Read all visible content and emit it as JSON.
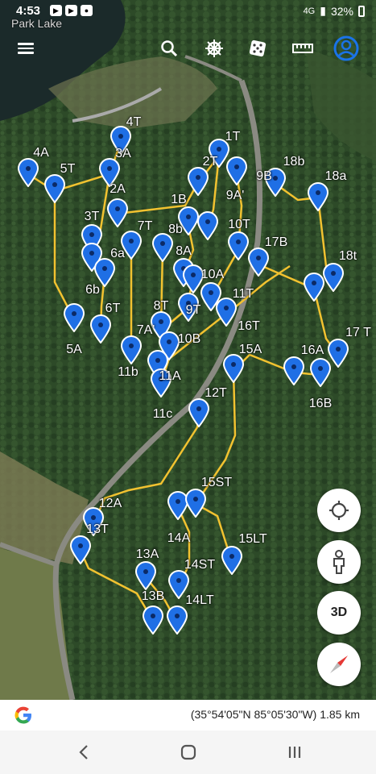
{
  "status_bar": {
    "time": "4:53",
    "signal": "4G",
    "battery": "32%"
  },
  "map_label": "Park Lake",
  "toolbar": {
    "menu": "menu-icon",
    "search": "search-icon",
    "voyager": "ship-wheel-icon",
    "feeling_lucky": "dice-icon",
    "measure": "ruler-icon",
    "account": "account-icon"
  },
  "controls": {
    "location": "my-location-icon",
    "street_view": "pegman-icon",
    "three_d": "3D",
    "compass": "compass-icon"
  },
  "footer": {
    "coordinates": "(35°54'05\"N 85°05'30\"W) 1.85 km"
  },
  "nav": {
    "back": "back-icon",
    "home": "home-icon",
    "recents": "recents-icon"
  },
  "colors": {
    "route": "#f2c230",
    "pin": "#1f6fe5",
    "accent": "#1a73e8"
  },
  "labels": [
    "4T",
    "4A",
    "3A",
    "5T",
    "2A",
    "1T",
    "2T",
    "18b",
    "9B",
    "18a",
    "1B",
    "9A'",
    "3T",
    "7T",
    "8b",
    "10T",
    "17B",
    "6a",
    "8A",
    "18t",
    "6b",
    "10A",
    "11T",
    "6T",
    "8T",
    "9T",
    "5A",
    "7A'",
    "10B",
    "16T",
    "17 T",
    "15A",
    "16A",
    "11b",
    "11A",
    "11c",
    "12T",
    "16B",
    "15ST",
    "12A",
    "13T",
    "14A",
    "15LT",
    "13A",
    "14ST",
    "13B",
    "14LT"
  ]
}
